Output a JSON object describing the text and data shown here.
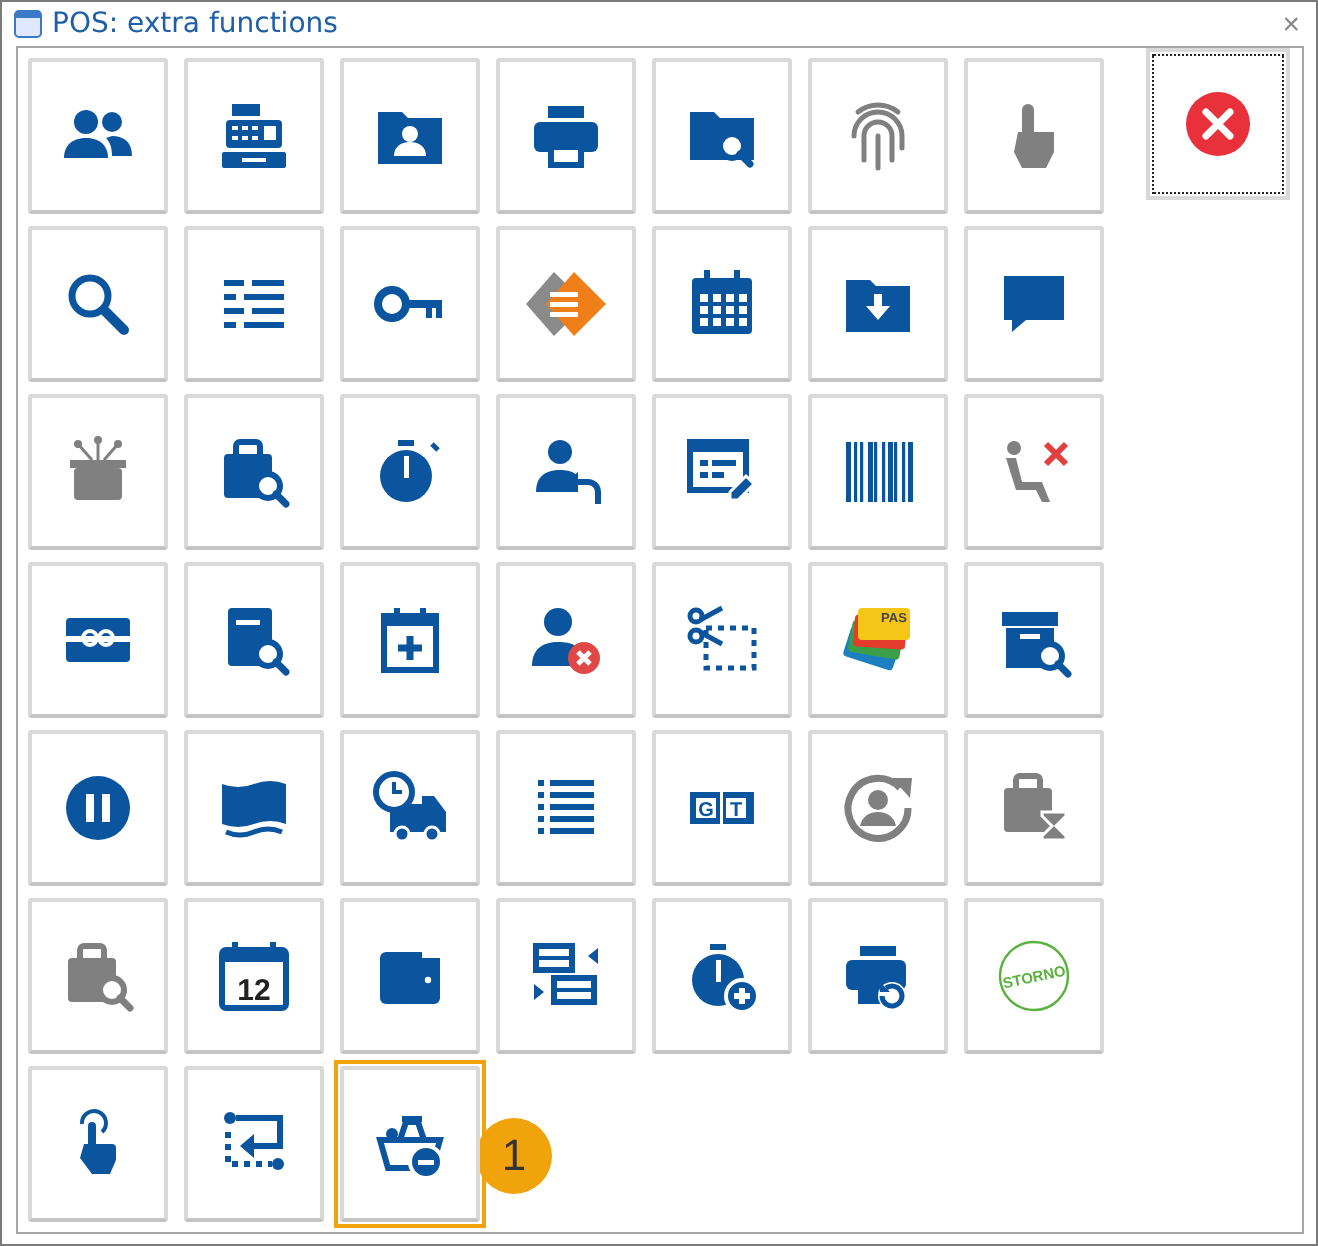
{
  "window": {
    "title": "POS: extra functions",
    "close": "×"
  },
  "buttons": [
    {
      "kind": "people",
      "selected": false
    },
    {
      "kind": "cash-register",
      "selected": false
    },
    {
      "kind": "contact-folder",
      "selected": false
    },
    {
      "kind": "printer",
      "selected": false
    },
    {
      "kind": "folder-search",
      "selected": false
    },
    {
      "kind": "fingerprint",
      "selected": false
    },
    {
      "kind": "hand",
      "selected": false
    },
    {
      "kind": "search",
      "selected": false
    },
    {
      "kind": "list",
      "selected": false
    },
    {
      "kind": "key",
      "selected": false
    },
    {
      "kind": "diamond",
      "selected": false
    },
    {
      "kind": "calendar",
      "selected": false
    },
    {
      "kind": "folder-download",
      "selected": false
    },
    {
      "kind": "chat",
      "selected": false
    },
    {
      "kind": "gift-box",
      "selected": false
    },
    {
      "kind": "bag-search",
      "selected": false
    },
    {
      "kind": "stopwatch",
      "selected": false
    },
    {
      "kind": "user-return",
      "selected": false
    },
    {
      "kind": "form-edit",
      "selected": false
    },
    {
      "kind": "barcode",
      "selected": false
    },
    {
      "kind": "seat-x",
      "selected": false
    },
    {
      "kind": "gift-card",
      "selected": false
    },
    {
      "kind": "document-search",
      "selected": false
    },
    {
      "kind": "calendar-plus",
      "selected": false
    },
    {
      "kind": "user-remove",
      "selected": false
    },
    {
      "kind": "scissors-cut",
      "selected": false
    },
    {
      "kind": "cards",
      "selected": false,
      "texts": [
        "PAS"
      ]
    },
    {
      "kind": "box-search",
      "selected": false
    },
    {
      "kind": "pause",
      "selected": false
    },
    {
      "kind": "ticket",
      "selected": false
    },
    {
      "kind": "truck-clock",
      "selected": false
    },
    {
      "kind": "dotted-list",
      "selected": false
    },
    {
      "kind": "letter-ticket",
      "selected": false,
      "texts": [
        "G",
        "T"
      ]
    },
    {
      "kind": "user-refresh",
      "selected": false
    },
    {
      "kind": "bag-hourglass",
      "selected": false
    },
    {
      "kind": "bag-search-grey",
      "selected": false
    },
    {
      "kind": "calendar-day",
      "selected": false,
      "texts": [
        "12"
      ]
    },
    {
      "kind": "wallet",
      "selected": false
    },
    {
      "kind": "swap",
      "selected": false
    },
    {
      "kind": "stopwatch-plus",
      "selected": false
    },
    {
      "kind": "printer-refresh",
      "selected": false
    },
    {
      "kind": "stamp",
      "selected": false,
      "texts": [
        "STORNO"
      ]
    },
    {
      "kind": "touch",
      "selected": false
    },
    {
      "kind": "route-back",
      "selected": false
    },
    {
      "kind": "basket-minus",
      "selected": true,
      "badge": "1"
    }
  ],
  "close_button": {
    "focused": true
  }
}
